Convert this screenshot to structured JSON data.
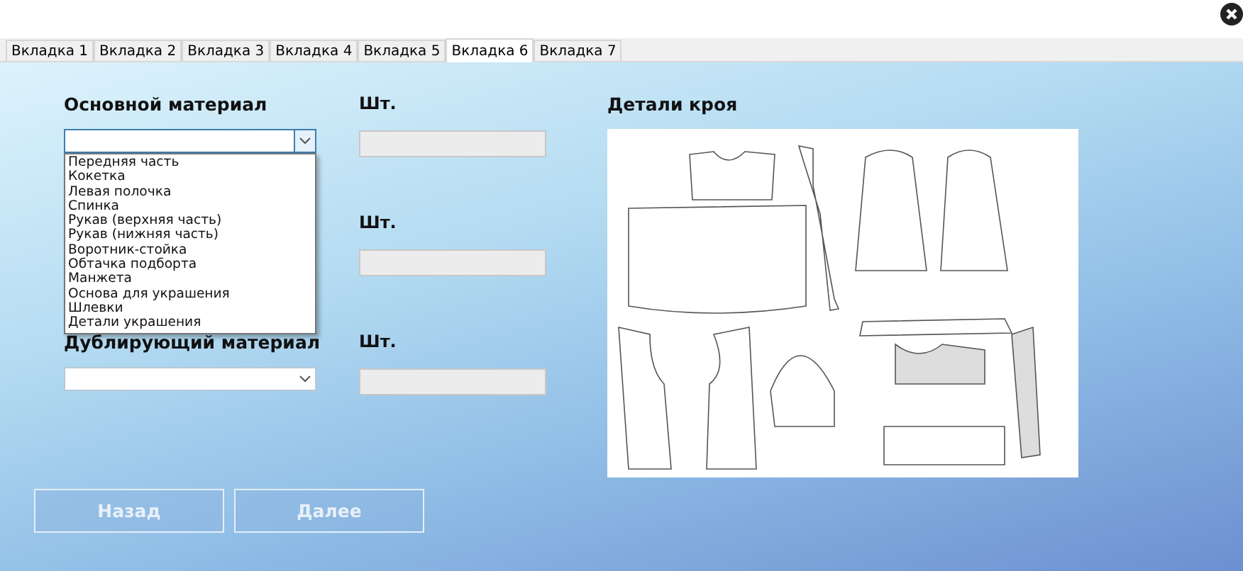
{
  "tabs": [
    {
      "label": "Вкладка 1",
      "selected": false
    },
    {
      "label": "Вкладка 2",
      "selected": false
    },
    {
      "label": "Вкладка 3",
      "selected": false
    },
    {
      "label": "Вкладка 4",
      "selected": false
    },
    {
      "label": "Вкладка 5",
      "selected": false
    },
    {
      "label": "Вкладка 6",
      "selected": true
    },
    {
      "label": "Вкладка 7",
      "selected": false
    }
  ],
  "sections": [
    {
      "label": "Основной материал",
      "qty_label": "Шт.",
      "expanded": true,
      "options": [
        "Передняя часть",
        "Кокетка",
        "Левая полочка",
        "Спинка",
        "Рукав (верхняя часть)",
        "Рукав (нижняя часть)",
        "Воротник-стойка",
        "Обтачка подборта",
        "Манжета",
        "Основа для украшения",
        "Шлевки",
        "Детали украшения"
      ]
    },
    {
      "qty_label": "Шт.",
      "expanded": false
    },
    {
      "label": "Дублирующий материал",
      "qty_label": "Шт.",
      "expanded": false
    }
  ],
  "preview": {
    "title": "Детали кроя"
  },
  "buttons": [
    "Назад",
    "Далее"
  ]
}
